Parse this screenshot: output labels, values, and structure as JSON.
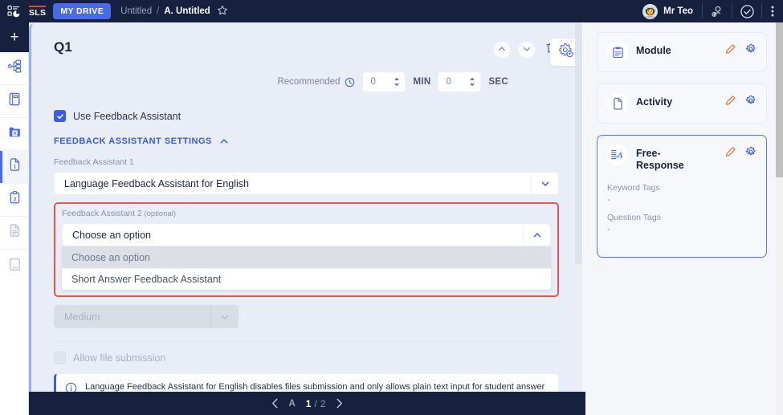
{
  "topbar": {
    "logo_icon": "sls-app-logo-icon",
    "sls_label": "SLS",
    "mydrive_label": "MY DRIVE",
    "breadcrumb_root": "Untitled",
    "breadcrumb_sep": "/",
    "breadcrumb_current": "A. Untitled",
    "favourite_icon": "star-bookmark-icon",
    "user_name": "Mr Teo",
    "avatar_glyph": "👩‍🚀",
    "add_user_icon": "add-person-icon",
    "check_icon": "check-circle-icon",
    "more_icon": "kebab-menu-icon"
  },
  "rail": {
    "add_label": "+",
    "items": [
      {
        "icon": "sitemap-icon",
        "name": "sidebar-item-structure"
      },
      {
        "icon": "notebook-icon",
        "name": "sidebar-item-notebook"
      },
      {
        "icon": "folder-a-icon",
        "name": "sidebar-item-assignment"
      },
      {
        "icon": "page-one-icon",
        "name": "sidebar-item-page-1"
      },
      {
        "icon": "clipboard-two-icon",
        "name": "sidebar-item-clipboard-2"
      },
      {
        "icon": "document-icon",
        "name": "sidebar-item-document"
      },
      {
        "icon": "book-icon",
        "name": "sidebar-item-book"
      }
    ]
  },
  "question": {
    "title": "Q1",
    "move_up_icon": "chevron-up-icon",
    "move_down_icon": "chevron-down-icon",
    "delete_icon": "trash-icon",
    "ai_settings_icon": "ai-gear-icon",
    "recommended_label": "Recommended",
    "clock_icon": "clock-icon",
    "minutes_value": "0",
    "minutes_unit": "MIN",
    "seconds_value": "0",
    "seconds_unit": "SEC"
  },
  "feedback": {
    "use_assistant_label": "Use Feedback Assistant",
    "use_assistant_checked": true,
    "settings_header": "FEEDBACK ASSISTANT SETTINGS",
    "collapse_icon": "chevron-up-icon",
    "assistant1_label": "Feedback Assistant 1",
    "assistant1_value": "Language Feedback Assistant for English",
    "assistant1_arrow_icon": "chevron-down-icon",
    "assistant2_label": "Feedback Assistant 2",
    "assistant2_label_optional": " (optional)",
    "assistant2_value": "Choose an option",
    "assistant2_arrow_icon": "chevron-up-icon",
    "assistant2_options": [
      {
        "label": "Choose an option",
        "selected": true
      },
      {
        "label": "Short Answer Feedback Assistant",
        "selected": false
      }
    ],
    "length_value": "Medium",
    "length_arrow_icon": "chevron-down-icon",
    "allow_file_label": "Allow file submission",
    "allow_file_checked": false,
    "info_icon": "info-circle-icon",
    "info_text": "Language Feedback Assistant for English disables files submission and only allows plain text input for student answer",
    "highlight_color": "#e8564a"
  },
  "rightpanel": {
    "cards": [
      {
        "title": "Module",
        "icon": "clipboard-icon",
        "edit_icon": "pencil-icon",
        "settings_icon": "gear-icon",
        "selected": false
      },
      {
        "title": "Activity",
        "icon": "file-icon",
        "edit_icon": "pencil-icon",
        "settings_icon": "gear-icon",
        "selected": false
      },
      {
        "title": "Free-Response",
        "icon": "free-response-icon",
        "edit_icon": "pencil-icon",
        "settings_icon": "gear-icon",
        "selected": true,
        "keyword_tags_label": "Keyword Tags",
        "keyword_tags_value": "-",
        "question_tags_label": "Question Tags",
        "question_tags_value": "-"
      }
    ]
  },
  "footer": {
    "prev_icon": "chevron-left-icon",
    "section_label": "A",
    "current_page": "1",
    "separator": "/",
    "total_pages": "2",
    "next_icon": "chevron-right-icon"
  },
  "colors": {
    "brand_navy": "#16213f",
    "accent_blue": "#3b5ce4",
    "highlight_red": "#e8564a",
    "pencil_orange": "#ef6b37",
    "card_bg": "#e9edf7"
  }
}
